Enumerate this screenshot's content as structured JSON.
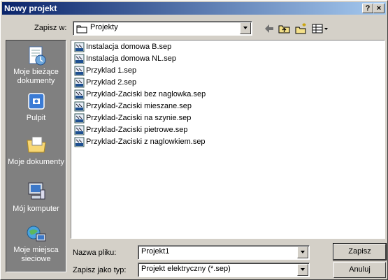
{
  "window": {
    "title": "Nowy projekt",
    "help_btn": "?",
    "close_btn": "×"
  },
  "location": {
    "label": "Zapisz w:",
    "value": "Projekty"
  },
  "places": [
    {
      "label": "Moje bieżące dokumenty",
      "icon": "recent-documents-icon"
    },
    {
      "label": "Pulpit",
      "icon": "desktop-icon"
    },
    {
      "label": "Moje dokumenty",
      "icon": "my-documents-icon"
    },
    {
      "label": "Mój komputer",
      "icon": "my-computer-icon"
    },
    {
      "label": "Moje miejsca sieciowe",
      "icon": "network-places-icon"
    }
  ],
  "files": [
    "Instalacja domowa B.sep",
    "Instalacja domowa NL.sep",
    "Przyklad 1.sep",
    "Przyklad 2.sep",
    "Przyklad-Zaciski bez naglowka.sep",
    "Przyklad-Zaciski mieszane.sep",
    "Przyklad-Zaciski na szynie.sep",
    "Przyklad-Zaciski pietrowe.sep",
    "Przyklad-Zaciski z naglowkiem.sep"
  ],
  "filename": {
    "label": "Nazwa pliku:",
    "value": "Projekt1"
  },
  "filetype": {
    "label": "Zapisz jako typ:",
    "value": "Projekt elektryczny (*.sep)"
  },
  "buttons": {
    "save": "Zapisz",
    "cancel": "Anuluj"
  },
  "colors": {
    "title_start": "#0a246a",
    "title_end": "#a6caf0",
    "places_bg": "#808080",
    "dialog_bg": "#d4d0c8"
  }
}
